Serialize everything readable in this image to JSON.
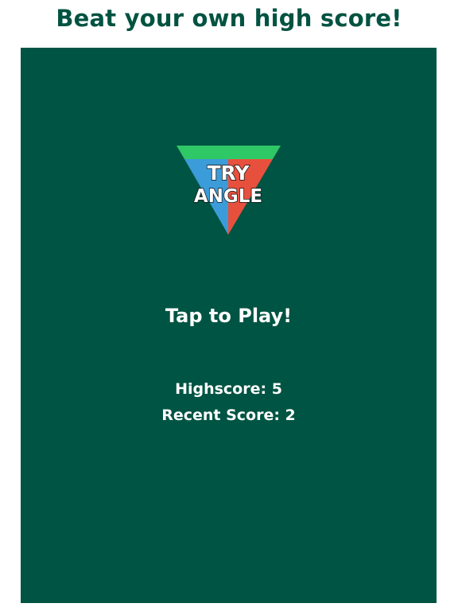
{
  "header": {
    "headline": "Beat your own high score!"
  },
  "game": {
    "background_color": "#005443",
    "logo": {
      "line1": "TRY",
      "line2": "ANGLE",
      "colors": {
        "top": "#2ec866",
        "left": "#3b9cd9",
        "right": "#e8503e"
      }
    },
    "prompt": "Tap to Play!",
    "highscore_text": "Highscore: 5",
    "recent_score_text": "Recent Score: 2"
  }
}
